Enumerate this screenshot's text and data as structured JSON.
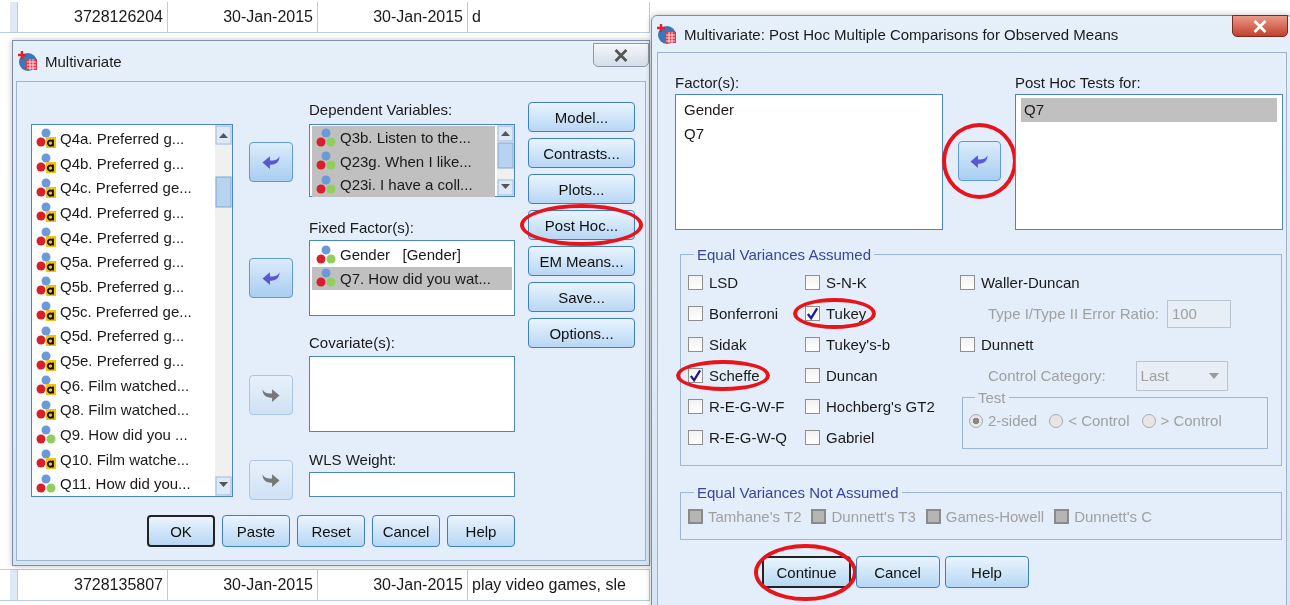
{
  "spreadsheet": {
    "rows": [
      [
        "3728126204",
        "30-Jan-2015",
        "30-Jan-2015",
        "d"
      ],
      [
        "3728135807",
        "30-Jan-2015",
        "30-Jan-2015",
        "play video games, sle"
      ]
    ]
  },
  "multivariate": {
    "title": "Multivariate",
    "active": false,
    "variables": [
      {
        "label": "Q4a. Preferred g...",
        "kind": "string"
      },
      {
        "label": "Q4b. Preferred g...",
        "kind": "string"
      },
      {
        "label": "Q4c. Preferred ge...",
        "kind": "string"
      },
      {
        "label": "Q4d. Preferred g...",
        "kind": "string"
      },
      {
        "label": "Q4e. Preferred g...",
        "kind": "string"
      },
      {
        "label": "Q5a. Preferred g...",
        "kind": "string"
      },
      {
        "label": "Q5b. Preferred g...",
        "kind": "string"
      },
      {
        "label": "Q5c. Preferred ge...",
        "kind": "string"
      },
      {
        "label": "Q5d. Preferred g...",
        "kind": "string"
      },
      {
        "label": "Q5e. Preferred g...",
        "kind": "string"
      },
      {
        "label": "Q6. Film watched...",
        "kind": "string"
      },
      {
        "label": "Q8. Film watched...",
        "kind": "string"
      },
      {
        "label": "Q9. How did you ...",
        "kind": "numeric"
      },
      {
        "label": "Q10. Film watche...",
        "kind": "string"
      },
      {
        "label": "Q11. How did you...",
        "kind": "numeric"
      }
    ],
    "arrows": [
      {
        "kind": "left",
        "disabled": false
      },
      {
        "kind": "left",
        "disabled": false
      },
      {
        "kind": "right",
        "disabled": true
      },
      {
        "kind": "right",
        "disabled": true
      }
    ],
    "dependent": {
      "label": "Dependent Variables:",
      "items": [
        {
          "label": "Q3b. Listen to the...",
          "selected": true
        },
        {
          "label": "Q23g. When I like...",
          "selected": true
        },
        {
          "label": "Q23i. I have a coll...",
          "selected": true
        }
      ]
    },
    "fixed": {
      "label": "Fixed Factor(s):",
      "items": [
        {
          "label": "Gender   [Gender]",
          "selected": false
        },
        {
          "label": "Q7. How did you wat...",
          "selected": true
        }
      ]
    },
    "covariates": {
      "label": "Covariate(s):"
    },
    "wls": {
      "label": "WLS Weight:"
    },
    "side_buttons": [
      {
        "label": "Model...",
        "circled": false
      },
      {
        "label": "Contrasts...",
        "circled": false
      },
      {
        "label": "Plots...",
        "circled": false
      },
      {
        "label": "Post Hoc...",
        "circled": true
      },
      {
        "label": "EM Means...",
        "circled": false
      },
      {
        "label": "Save...",
        "circled": false
      },
      {
        "label": "Options...",
        "circled": false
      }
    ],
    "buttons": [
      {
        "label": "OK",
        "default": true
      },
      {
        "label": "Paste",
        "default": false
      },
      {
        "label": "Reset",
        "default": false
      },
      {
        "label": "Cancel",
        "default": false
      },
      {
        "label": "Help",
        "default": false
      }
    ]
  },
  "post_hoc": {
    "title": "Multivariate: Post Hoc Multiple Comparisons for Observed Means",
    "active": true,
    "factors": {
      "label": "Factor(s):",
      "items": [
        {
          "label": "Gender",
          "selected": false
        },
        {
          "label": "Q7",
          "selected": false
        }
      ]
    },
    "arrow": {
      "kind": "left",
      "disabled": false,
      "circled": true
    },
    "tests_for": {
      "label": "Post Hoc Tests for:",
      "items": [
        {
          "label": "Q7",
          "selected": true
        }
      ]
    },
    "equal_assumed": {
      "title": "Equal Variances Assumed",
      "columns": [
        [
          {
            "kind": "checkbox",
            "label": "LSD",
            "checked": false,
            "circled": false
          },
          {
            "kind": "checkbox",
            "label": "Bonferroni",
            "checked": false,
            "circled": false
          },
          {
            "kind": "checkbox",
            "label": "Sidak",
            "checked": false,
            "circled": false
          },
          {
            "kind": "checkbox",
            "label": "Scheffe",
            "checked": true,
            "circled": true
          },
          {
            "kind": "checkbox",
            "label": "R-E-G-W-F",
            "checked": false,
            "circled": false
          },
          {
            "kind": "checkbox",
            "label": "R-E-G-W-Q",
            "checked": false,
            "circled": false
          }
        ],
        [
          {
            "kind": "checkbox",
            "label": "S-N-K",
            "checked": false,
            "circled": false
          },
          {
            "kind": "checkbox",
            "label": "Tukey",
            "checked": true,
            "circled": true
          },
          {
            "kind": "checkbox",
            "label": "Tukey's-b",
            "checked": false,
            "circled": false
          },
          {
            "kind": "checkbox",
            "label": "Duncan",
            "checked": false,
            "circled": false
          },
          {
            "kind": "checkbox",
            "label": "Hochberg's GT2",
            "checked": false,
            "circled": false
          },
          {
            "kind": "checkbox",
            "label": "Gabriel",
            "checked": false,
            "circled": false
          }
        ],
        [
          {
            "kind": "checkbox",
            "label": "Waller-Duncan",
            "checked": false,
            "circled": false
          },
          {
            "kind": "field",
            "label": "Type I/Type II Error Ratio:",
            "value": "100",
            "disabled": true
          },
          {
            "kind": "checkbox",
            "label": "Dunnett",
            "checked": false,
            "circled": false
          },
          {
            "kind": "dropdown",
            "label": "Control Category:",
            "value": "Last",
            "disabled": true
          },
          {
            "kind": "radio-group",
            "title": "Test",
            "disabled": true,
            "options": [
              {
                "label": "2-sided",
                "selected": true
              },
              {
                "label": "< Control",
                "selected": false
              },
              {
                "label": "> Control",
                "selected": false
              }
            ]
          }
        ]
      ]
    },
    "equal_not_assumed": {
      "title": "Equal Variances Not Assumed",
      "items": [
        {
          "label": "Tamhane's T2",
          "checked": false,
          "disabled": true
        },
        {
          "label": "Dunnett's T3",
          "checked": false,
          "disabled": true
        },
        {
          "label": "Games-Howell",
          "checked": false,
          "disabled": true
        },
        {
          "label": "Dunnett's C",
          "checked": false,
          "disabled": true
        }
      ]
    },
    "buttons": [
      {
        "label": "Continue",
        "default": true,
        "circled": true
      },
      {
        "label": "Cancel",
        "default": false,
        "circled": false
      },
      {
        "label": "Help",
        "default": false,
        "circled": false
      }
    ]
  }
}
